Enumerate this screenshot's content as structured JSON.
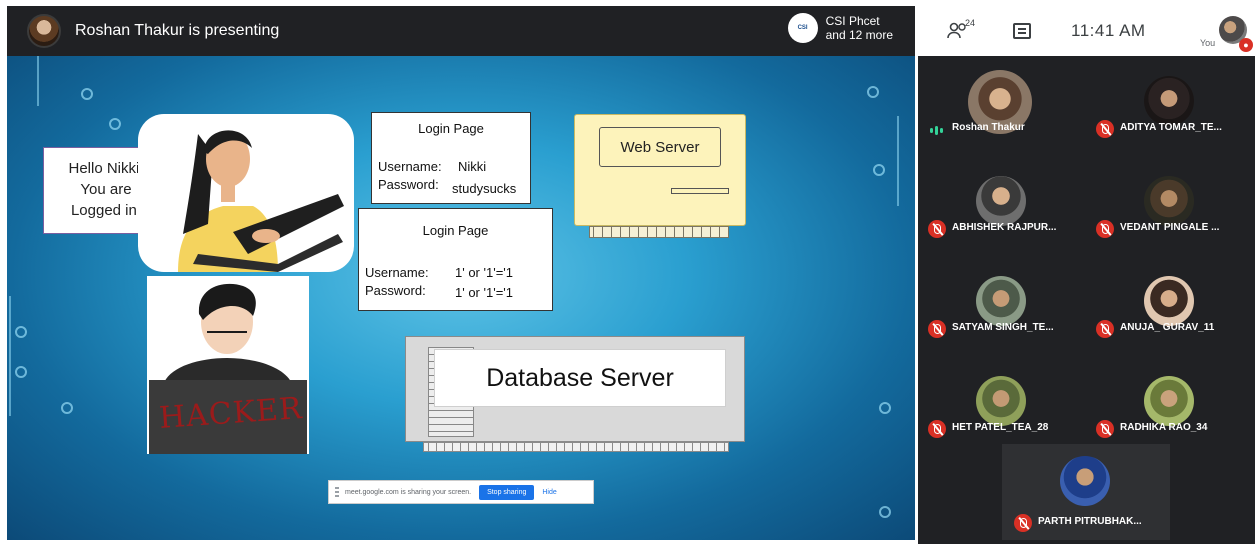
{
  "topbar": {
    "presenting_text": "Roshan Thakur is presenting",
    "others_line1": "CSI Phcet",
    "others_line2": "and 12 more",
    "logo_text": "CSI"
  },
  "header": {
    "participant_count": "24",
    "time": "11:41 AM",
    "you_label": "You"
  },
  "slide": {
    "speech_line1": "Hello Nikki,",
    "speech_line2": "You are",
    "speech_line3": "Logged in.",
    "login1": {
      "title": "Login Page",
      "username_label": "Username:",
      "username_value": "Nikki",
      "password_label": "Password:",
      "password_value": "studysucks"
    },
    "login2": {
      "title": "Login Page",
      "username_label": "Username:",
      "username_value": "1' or '1'='1",
      "password_label": "Password:",
      "password_value": "1' or '1'='1"
    },
    "web_server_label": "Web Server",
    "database_server_label": "Database Server",
    "hacker_text": "HACKER"
  },
  "share_bar": {
    "message": "meet.google.com is sharing your screen.",
    "stop_label": "Stop sharing",
    "hide_label": "Hide"
  },
  "participants": [
    {
      "name": "Roshan Thakur",
      "speaking": true
    },
    {
      "name": "ADITYA TOMAR_TE...",
      "muted": true
    },
    {
      "name": "ABHISHEK RAJPUR...",
      "muted": true
    },
    {
      "name": "VEDANT PINGALE ...",
      "muted": true
    },
    {
      "name": "SATYAM SINGH_TE...",
      "muted": true
    },
    {
      "name": "ANUJA_ GURAV_11",
      "muted": true
    },
    {
      "name": "HET PATEL_TEA_28",
      "muted": true
    },
    {
      "name": "RADHIKA RAO_34",
      "muted": true
    },
    {
      "name": "PARTH PITRUBHAK...",
      "muted": true
    }
  ],
  "colors": {
    "meet_dark": "#202124",
    "mute_red": "#d93025",
    "speaking_green": "#34d399",
    "share_blue": "#1a73e8"
  }
}
